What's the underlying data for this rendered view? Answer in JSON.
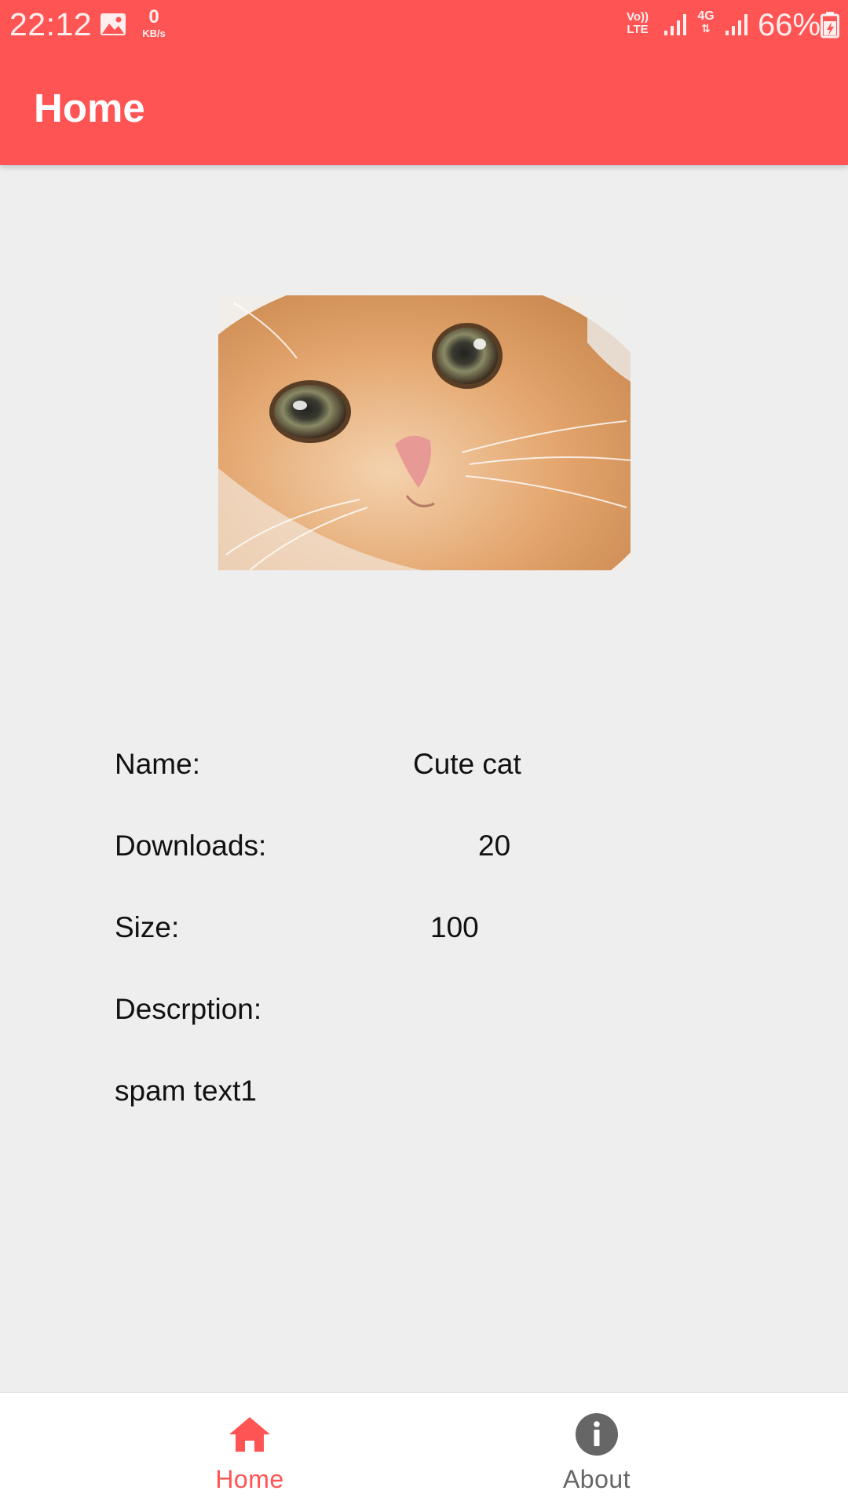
{
  "status_bar": {
    "time": "22:12",
    "speed_value": "0",
    "speed_unit": "KB/s",
    "volte_line1": "Vo))",
    "volte_line2": "LTE",
    "network": "4G",
    "battery": "66%"
  },
  "app_bar": {
    "title": "Home",
    "color": "#ff5454"
  },
  "details": {
    "name_label": "Name:",
    "name_value": "Cute cat",
    "downloads_label": "Downloads:",
    "downloads_value": "20",
    "size_label": "Size:",
    "size_value": "100",
    "description_label": "Descrption:",
    "description_value": "spam text1"
  },
  "bottom_nav": {
    "items": [
      {
        "label": "Home",
        "icon": "home-icon",
        "active": true
      },
      {
        "label": "About",
        "icon": "info-icon",
        "active": false
      }
    ],
    "active_color": "#ff5454",
    "inactive_color": "#666666"
  }
}
